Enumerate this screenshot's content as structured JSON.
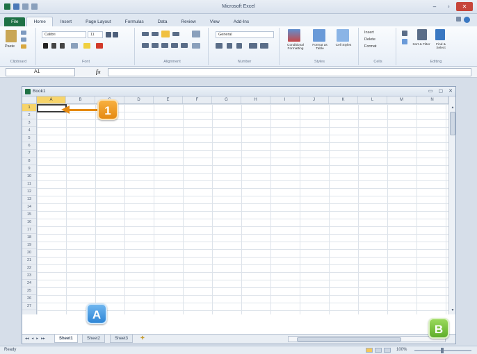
{
  "app": {
    "title": "Microsoft Excel",
    "window_controls": [
      "–",
      "▫",
      "✕"
    ]
  },
  "ribbon": {
    "tabs": [
      {
        "label": "File"
      },
      {
        "label": "Home"
      },
      {
        "label": "Insert"
      },
      {
        "label": "Page Layout"
      },
      {
        "label": "Formulas"
      },
      {
        "label": "Data"
      },
      {
        "label": "Review"
      },
      {
        "label": "View"
      },
      {
        "label": "Add-Ins"
      }
    ],
    "active_tab": "Home",
    "groups": [
      {
        "label": "Clipboard"
      },
      {
        "label": "Font"
      },
      {
        "label": "Alignment"
      },
      {
        "label": "Number"
      },
      {
        "label": "Styles"
      },
      {
        "label": "Cells"
      },
      {
        "label": "Editing"
      }
    ],
    "font_name": "Calibri",
    "font_size": "11",
    "number_format": "General",
    "paste_label": "Paste",
    "styles_buttons": [
      "Conditional Formatting",
      "Format as Table",
      "Cell Styles"
    ],
    "cells_buttons": [
      "Insert",
      "Delete",
      "Format"
    ],
    "editing_buttons": [
      "Sort & Filter",
      "Find & Select"
    ]
  },
  "formula_bar": {
    "name_box": "A1",
    "fx_label": "fx",
    "value": ""
  },
  "workbook": {
    "title": "Book1",
    "column_headers": [
      "A",
      "B",
      "C",
      "D",
      "E",
      "F",
      "G",
      "H",
      "I",
      "J",
      "K",
      "L",
      "M",
      "N"
    ],
    "selected_column": "A",
    "row_headers": [
      "1",
      "2",
      "3",
      "4",
      "5",
      "6",
      "7",
      "8",
      "9",
      "10",
      "11",
      "12",
      "13",
      "14",
      "15",
      "16",
      "17",
      "18",
      "19",
      "20",
      "21",
      "22",
      "23",
      "24",
      "25",
      "26",
      "27"
    ],
    "selected_row": "1",
    "sheet_tabs": [
      "Sheet1",
      "Sheet2",
      "Sheet3"
    ],
    "active_sheet": "Sheet1"
  },
  "status_bar": {
    "status": "Ready",
    "zoom": "100%"
  },
  "callouts": {
    "one": "1",
    "a": "A",
    "b": "B"
  },
  "colors": {
    "file_tab": "#1e7145",
    "callout_orange": "#e58a11",
    "callout_blue": "#2f86d6",
    "callout_green": "#5fae2a",
    "selection_header": "#f7d46a"
  }
}
